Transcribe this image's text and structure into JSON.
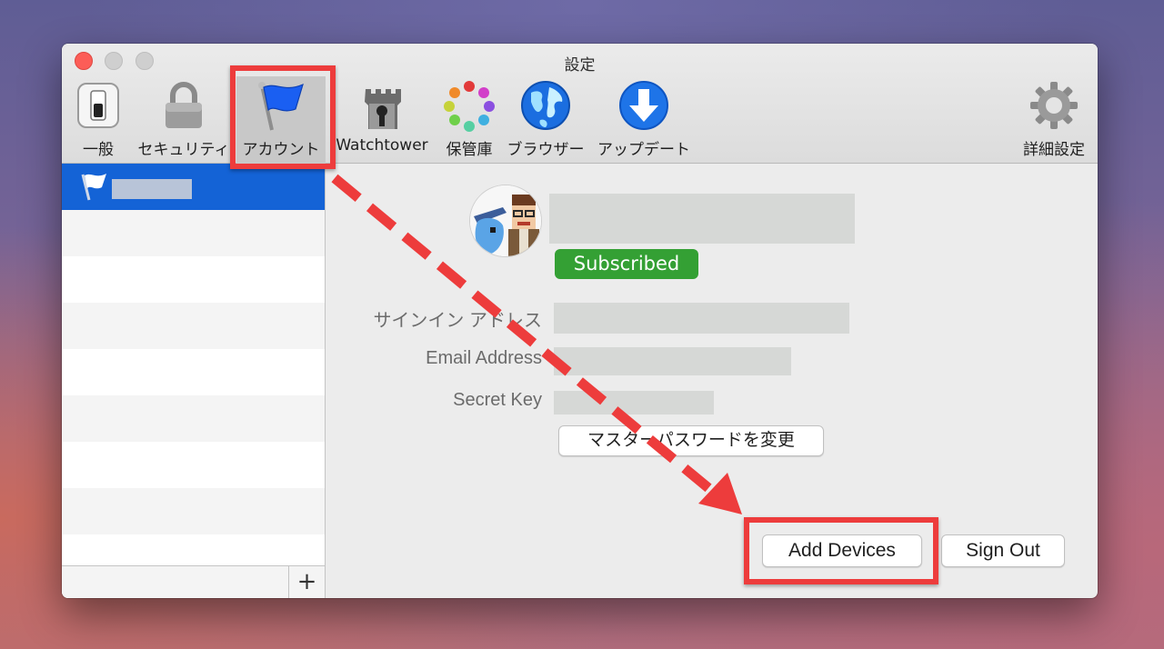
{
  "window": {
    "title": "設定"
  },
  "toolbar": [
    {
      "id": "general",
      "label": "一般",
      "icon": "switch-icon"
    },
    {
      "id": "security",
      "label": "セキュリティ",
      "icon": "lock-icon"
    },
    {
      "id": "accounts",
      "label": "アカウント",
      "icon": "flag-icon",
      "active": true
    },
    {
      "id": "watchtower",
      "label": "Watchtower",
      "icon": "tower-icon"
    },
    {
      "id": "vaults",
      "label": "保管庫",
      "icon": "vault-dots-icon"
    },
    {
      "id": "browsers",
      "label": "ブラウザー",
      "icon": "globe-icon"
    },
    {
      "id": "updates",
      "label": "アップデート",
      "icon": "download-arrow-icon"
    },
    {
      "id": "advanced",
      "label": "詳細設定",
      "icon": "gear-icon"
    }
  ],
  "sidebar": {
    "selected_account_icon": "flag-icon",
    "add_button": "+"
  },
  "account": {
    "status_badge": "Subscribed",
    "fields": [
      {
        "label": "サインイン アドレス"
      },
      {
        "label": "Email Address"
      },
      {
        "label": "Secret Key"
      }
    ],
    "change_password_button": "マスターパスワードを変更",
    "add_devices_button": "Add Devices",
    "sign_out_button": "Sign Out"
  },
  "annotation": {
    "highlight_color": "#ed3c3c",
    "arrow_style": "dashed"
  }
}
